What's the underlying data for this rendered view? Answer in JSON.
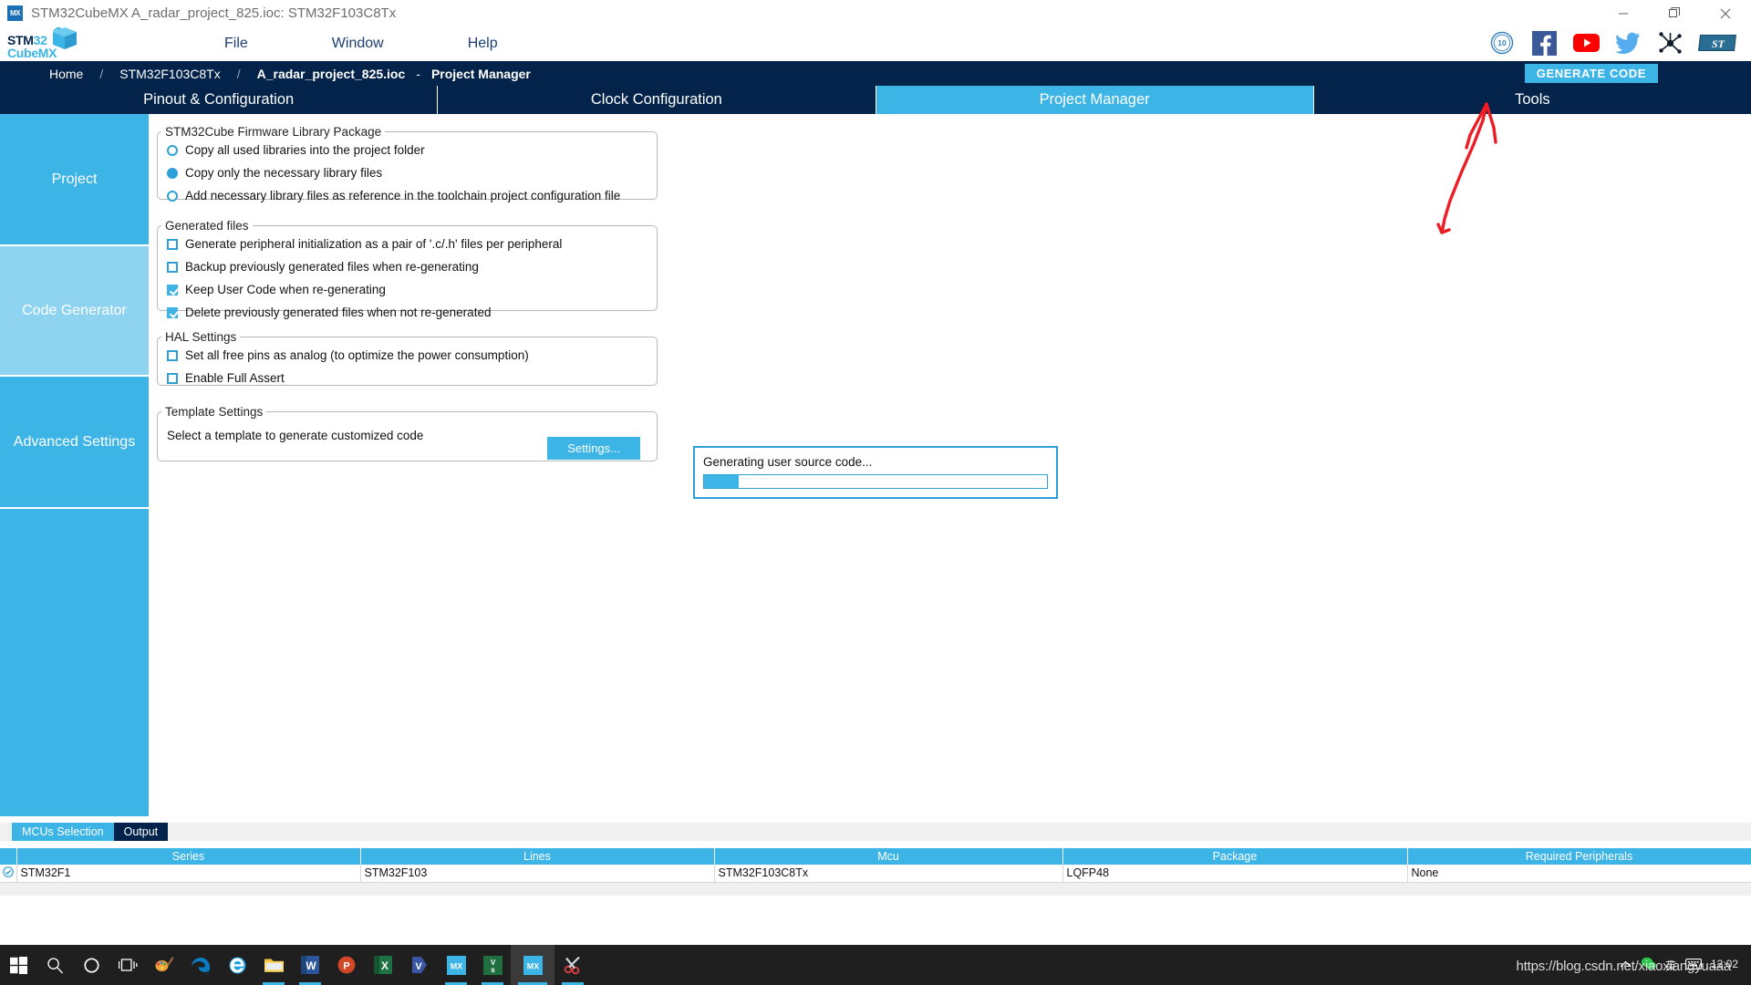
{
  "window": {
    "app_icon": "mx-icon",
    "title": "STM32CubeMX A_radar_project_825.ioc: STM32F103C8Tx",
    "minimize_label": "minimize-icon",
    "restore_label": "restore-icon",
    "close_label": "close-icon"
  },
  "brand": {
    "line1_a": "STM",
    "line1_b": "32",
    "line2": "CubeMX",
    "color_primary": "#03234b",
    "color_accent": "#3cb4e6"
  },
  "menu": {
    "items": [
      {
        "label": "File"
      },
      {
        "label": "Window"
      },
      {
        "label": "Help"
      }
    ]
  },
  "social": {
    "items": [
      {
        "name": "ten-years-badge-icon",
        "title": "10 YEARS"
      },
      {
        "name": "facebook-icon",
        "title": "Facebook"
      },
      {
        "name": "youtube-icon",
        "title": "YouTube"
      },
      {
        "name": "twitter-icon",
        "title": "Twitter"
      },
      {
        "name": "community-network-icon",
        "title": "ST Community"
      },
      {
        "name": "st-logo-icon",
        "title": "ST"
      }
    ]
  },
  "breadcrumb": {
    "home": "Home",
    "sep1": "/",
    "mcu": "STM32F103C8Tx",
    "sep2": "/",
    "file": "A_radar_project_825.ioc",
    "dash": "-",
    "page": "Project Manager",
    "generate_code": "GENERATE CODE"
  },
  "tabs": [
    {
      "label": "Pinout & Configuration",
      "active": false
    },
    {
      "label": "Clock Configuration",
      "active": false
    },
    {
      "label": "Project Manager",
      "active": true
    },
    {
      "label": "Tools",
      "active": false
    }
  ],
  "sidebar": {
    "items": [
      {
        "label": "Project",
        "selected": false
      },
      {
        "label": "Code Generator",
        "selected": true
      },
      {
        "label": "Advanced Settings",
        "selected": false
      }
    ]
  },
  "groups": {
    "firmware": {
      "legend": "STM32Cube Firmware Library Package",
      "options": [
        {
          "label": "Copy all used libraries into the project folder",
          "checked": false
        },
        {
          "label": "Copy only the necessary library files",
          "checked": true
        },
        {
          "label": "Add necessary library files as reference in the toolchain project configuration file",
          "checked": false
        }
      ]
    },
    "generated_files": {
      "legend": "Generated files",
      "options": [
        {
          "label": "Generate peripheral initialization as a pair of '.c/.h' files per peripheral",
          "checked": false
        },
        {
          "label": "Backup previously generated files when re-generating",
          "checked": false
        },
        {
          "label": "Keep User Code when re-generating",
          "checked": true
        },
        {
          "label": "Delete previously generated files when not re-generated",
          "checked": true
        }
      ]
    },
    "hal_settings": {
      "legend": "HAL Settings",
      "options": [
        {
          "label": "Set all free pins as analog (to optimize the power consumption)",
          "checked": false
        },
        {
          "label": "Enable Full Assert",
          "checked": false
        }
      ]
    },
    "template_settings": {
      "legend": "Template Settings",
      "description": "Select a template to generate customized code",
      "button": "Settings..."
    }
  },
  "dialog": {
    "message": "Generating user source code...",
    "progress_percent": 10
  },
  "annotation": {
    "name": "red-arrow-annotation",
    "color": "#ee1c24"
  },
  "bottom_panel": {
    "tabs": [
      {
        "label": "MCUs Selection",
        "state": "selected"
      },
      {
        "label": "Output",
        "state": "inactive"
      }
    ],
    "table": {
      "columns": [
        "",
        "Series",
        "Lines",
        "Mcu",
        "Package",
        "Required Peripherals"
      ],
      "rows": [
        {
          "checked": true,
          "series": "STM32F1",
          "lines": "STM32F103",
          "mcu": "STM32F103C8Tx",
          "package": "LQFP48",
          "required_peripherals": "None"
        }
      ]
    }
  },
  "taskbar": {
    "items": [
      {
        "name": "start-button",
        "glyph": "windows"
      },
      {
        "name": "search-icon",
        "glyph": "search"
      },
      {
        "name": "cortana-icon",
        "glyph": "cortana"
      },
      {
        "name": "task-view-icon",
        "glyph": "taskview"
      },
      {
        "name": "paint-3d-icon",
        "glyph": "paint",
        "running": false
      },
      {
        "name": "edge-icon",
        "glyph": "edge",
        "running": true
      },
      {
        "name": "internet-explorer-icon",
        "glyph": "ie",
        "running": false
      },
      {
        "name": "file-explorer-icon",
        "glyph": "folder",
        "running": true
      },
      {
        "name": "word-icon",
        "glyph": "word",
        "running": true
      },
      {
        "name": "powerpoint-icon",
        "glyph": "ppt",
        "running": false
      },
      {
        "name": "excel-icon",
        "glyph": "excel",
        "running": false
      },
      {
        "name": "visio-icon",
        "glyph": "visio",
        "running": false
      },
      {
        "name": "cubemx-icon",
        "glyph": "mx",
        "running": true
      },
      {
        "name": "visual-studio-icon",
        "glyph": "vs",
        "running": true
      },
      {
        "name": "cubemx-active-icon",
        "glyph": "mx",
        "running": true,
        "active": true
      },
      {
        "name": "snipping-tool-icon",
        "glyph": "snip",
        "running": true
      }
    ],
    "tray": {
      "chevron": "show-hidden-icons",
      "wechat": "wechat-icon",
      "ime": "英",
      "keyboard": "keyboard-icon",
      "time": "12:02"
    },
    "watermark": "https://blog.csdn.net/xiaoxiangyuaaa"
  }
}
